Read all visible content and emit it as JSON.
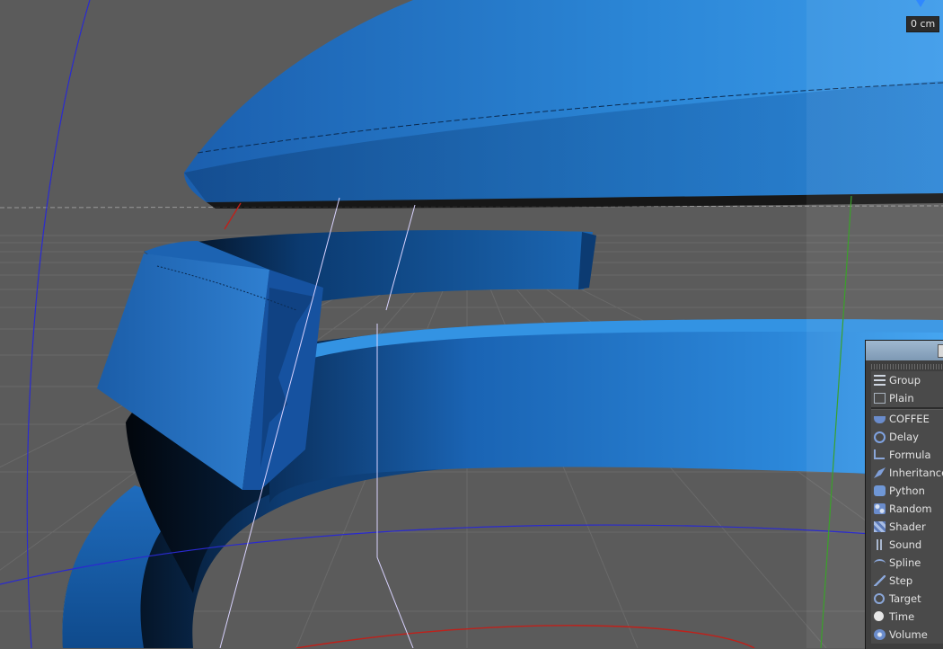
{
  "viewport": {
    "distance_readout": "0 cm",
    "colors": {
      "background": "#5b5b5b",
      "object_blue": "#1f6fc0",
      "grid_line": "#6a6a6a",
      "axis_x": "#c0201a",
      "axis_y": "#3aa12a",
      "axis_z": "#2a2ad0"
    }
  },
  "node_menu": {
    "items_top": [
      {
        "label": "Group",
        "icon": "group-icon"
      },
      {
        "label": "Plain",
        "icon": "plain-icon"
      }
    ],
    "items": [
      {
        "label": "COFFEE",
        "icon": "coffee-icon"
      },
      {
        "label": "Delay",
        "icon": "delay-icon"
      },
      {
        "label": "Formula",
        "icon": "formula-icon"
      },
      {
        "label": "Inheritance",
        "icon": "inheritance-icon"
      },
      {
        "label": "Python",
        "icon": "python-icon"
      },
      {
        "label": "Random",
        "icon": "random-icon"
      },
      {
        "label": "Shader",
        "icon": "shader-icon"
      },
      {
        "label": "Sound",
        "icon": "sound-icon"
      },
      {
        "label": "Spline",
        "icon": "spline-icon"
      },
      {
        "label": "Step",
        "icon": "step-icon"
      },
      {
        "label": "Target",
        "icon": "target-icon"
      },
      {
        "label": "Time",
        "icon": "time-icon"
      },
      {
        "label": "Volume",
        "icon": "volume-icon"
      }
    ]
  }
}
